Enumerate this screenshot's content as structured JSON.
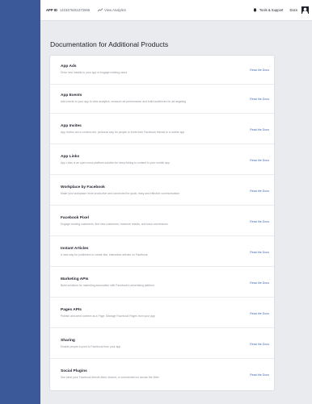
{
  "topbar": {
    "app_id_label": "APP ID",
    "app_id_value": "1423476451372565",
    "analytics_label": "View Analytics",
    "tools_label": "Tools & Support",
    "docs_label": "Docs"
  },
  "main": {
    "title": "Documentation for Additional Products",
    "products": [
      {
        "title": "App Ads",
        "description": "Drive new installs to your app or engage existing users",
        "link": "Read the Docs"
      },
      {
        "title": "App Events",
        "description": "Add events to your app to view analytics, measure ad performance and build audiences for ad targeting",
        "link": "Read the Docs"
      },
      {
        "title": "App Invites",
        "description": "App Invites are a content-rich, personal way for people to invite their Facebook friends to a mobile app",
        "link": "Read the Docs"
      },
      {
        "title": "App Links",
        "description": "App Links is an open cross platform solution for deep linking to content in your mobile app",
        "link": "Read the Docs"
      },
      {
        "title": "Workplace by Facebook",
        "description": "Make your workplace more productive and connected for quick, easy and effective communication",
        "link": "Read the Docs"
      },
      {
        "title": "Facebook Pixel",
        "description": "Engage existing customers, find new customers, measure results, and track conversions",
        "link": "Read the Docs"
      },
      {
        "title": "Instant Articles",
        "description": "A new way for publishers to create fast, interactive articles on Facebook",
        "link": "Read the Docs"
      },
      {
        "title": "Marketing APIs",
        "description": "Build solutions for marketing automation with Facebook's advertising platform",
        "link": "Read the Docs"
      },
      {
        "title": "Pages APIs",
        "description": "Publish and send content as a Page. Manage Facebook Pages from your app",
        "link": "Read the Docs"
      },
      {
        "title": "Sharing",
        "description": "Enable people to post to Facebook from your app",
        "link": "Read the Docs"
      },
      {
        "title": "Social Plugins",
        "description": "See what your Facebook friends liked, shared, or commented on across the Web",
        "link": "Read the Docs"
      }
    ]
  },
  "colors": {
    "brand": "#3b5998",
    "link": "#4267b2",
    "background": "#e9ebee"
  }
}
